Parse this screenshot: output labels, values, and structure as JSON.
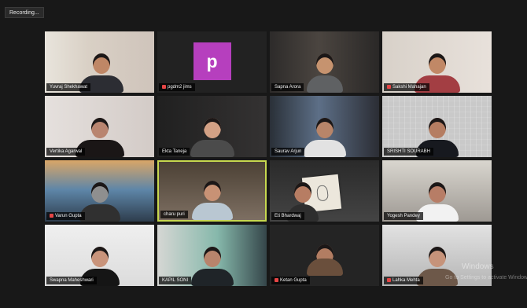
{
  "recording_label": "Recording...",
  "participants": [
    {
      "name": "Yuvraj Shekhawat",
      "muted": false
    },
    {
      "name": "pgdm2 jims",
      "muted": true,
      "avatar_letter": "p",
      "avatar_color": "#b63fbe"
    },
    {
      "name": "Sapna Arora",
      "muted": false
    },
    {
      "name": "Sakshi Mahajan",
      "muted": true
    },
    {
      "name": "Vertika Agarwal",
      "muted": false
    },
    {
      "name": "Ekta Taneja",
      "muted": false
    },
    {
      "name": "Saurav Arjun",
      "muted": false
    },
    {
      "name": "SRISHTI SOURABH",
      "muted": false
    },
    {
      "name": "Varun Gupta",
      "muted": true
    },
    {
      "name": "charu puri",
      "muted": false,
      "active": true
    },
    {
      "name": "Eti Bhardwaj",
      "muted": false
    },
    {
      "name": "Yogesh Pandey",
      "muted": false
    },
    {
      "name": "Swapna Maheshwari",
      "muted": false
    },
    {
      "name": "KAPIL SONI",
      "muted": false
    },
    {
      "name": "Ketan Gupta",
      "muted": true
    },
    {
      "name": "Lahka Mehta",
      "muted": true
    }
  ],
  "watermark": {
    "title": "Windows",
    "subtitle": "Go to Settings to activate Windows."
  },
  "colors": {
    "background": "#181818",
    "active_border": "#c7d84f",
    "mute_red": "#e54545"
  }
}
